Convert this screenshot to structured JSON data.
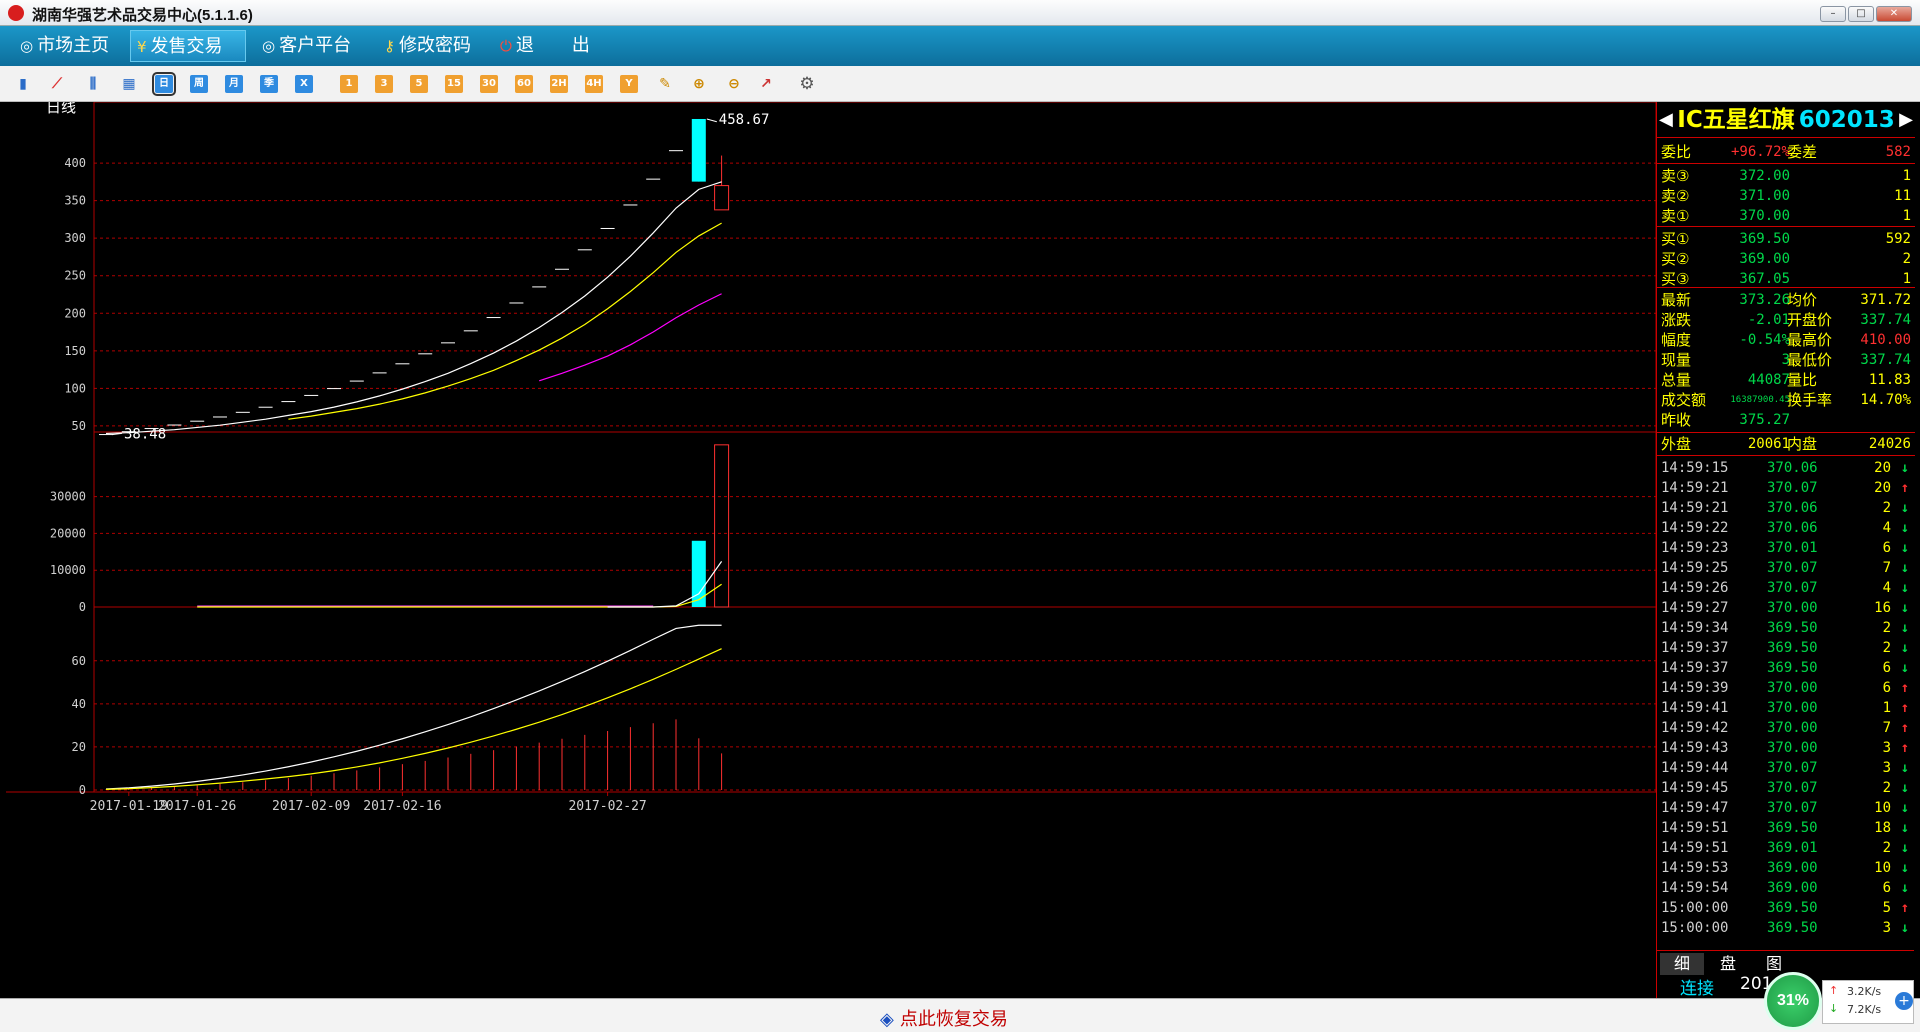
{
  "window": {
    "title": "湖南华强艺术品交易中心(5.1.1.6)"
  },
  "menu": [
    {
      "label": "市场主页",
      "icon": "swirl-icon"
    },
    {
      "label": "发售交易",
      "icon": "yen-icon"
    },
    {
      "label": "客户平台",
      "icon": "swirl-icon"
    },
    {
      "label": "修改密码",
      "icon": "key-icon"
    },
    {
      "label": "退",
      "icon": "power-icon"
    },
    {
      "label": "出",
      "icon": ""
    }
  ],
  "toolbar": {
    "period_labels": [
      "日",
      "周",
      "月",
      "季",
      "X"
    ],
    "minute_labels": [
      "1",
      "3",
      "5",
      "15",
      "30",
      "60",
      "2H",
      "4H",
      "Y"
    ]
  },
  "chart_data": [
    {
      "type": "candlestick",
      "label": "日线",
      "yticks": [
        50,
        100,
        150,
        200,
        250,
        300,
        350,
        400
      ],
      "ylim": [
        41.9,
        468
      ],
      "x_tick_labels": [
        "2017-01-19",
        "2017-01-26",
        "2017-02-09",
        "2017-02-16",
        "2017-02-27"
      ],
      "high_annotation": "458.67",
      "low_annotation": "38.48",
      "bars": [
        {
          "o": 38.5,
          "h": 38.5,
          "l": 38.5,
          "c": 38.5
        },
        {
          "o": 42.3,
          "h": 42.3,
          "l": 42.3,
          "c": 42.3
        },
        {
          "o": 46.5,
          "h": 46.5,
          "l": 46.5,
          "c": 46.5
        },
        {
          "o": 51.2,
          "h": 51.2,
          "l": 51.2,
          "c": 51.2
        },
        {
          "o": 56.3,
          "h": 56.3,
          "l": 56.3,
          "c": 56.3
        },
        {
          "o": 61.9,
          "h": 61.9,
          "l": 61.9,
          "c": 61.9
        },
        {
          "o": 68.1,
          "h": 68.1,
          "l": 68.1,
          "c": 68.1
        },
        {
          "o": 74.9,
          "h": 74.9,
          "l": 74.9,
          "c": 74.9
        },
        {
          "o": 82.4,
          "h": 82.4,
          "l": 82.4,
          "c": 82.4
        },
        {
          "o": 90.6,
          "h": 90.6,
          "l": 90.6,
          "c": 90.6
        },
        {
          "o": 99.7,
          "h": 99.7,
          "l": 99.7,
          "c": 99.7
        },
        {
          "o": 109.7,
          "h": 109.7,
          "l": 109.7,
          "c": 109.7
        },
        {
          "o": 120.6,
          "h": 120.6,
          "l": 120.6,
          "c": 120.6
        },
        {
          "o": 132.7,
          "h": 132.7,
          "l": 132.7,
          "c": 132.7
        },
        {
          "o": 146.0,
          "h": 146.0,
          "l": 146.0,
          "c": 146.0
        },
        {
          "o": 160.6,
          "h": 160.6,
          "l": 160.6,
          "c": 160.6
        },
        {
          "o": 176.6,
          "h": 176.6,
          "l": 176.6,
          "c": 176.6
        },
        {
          "o": 194.3,
          "h": 194.3,
          "l": 194.3,
          "c": 194.3
        },
        {
          "o": 213.7,
          "h": 213.7,
          "l": 213.7,
          "c": 213.7
        },
        {
          "o": 235.1,
          "h": 235.1,
          "l": 235.1,
          "c": 235.1
        },
        {
          "o": 258.6,
          "h": 258.6,
          "l": 258.6,
          "c": 258.6
        },
        {
          "o": 284.5,
          "h": 284.5,
          "l": 284.5,
          "c": 284.5
        },
        {
          "o": 312.9,
          "h": 312.9,
          "l": 312.9,
          "c": 312.9
        },
        {
          "o": 344.2,
          "h": 344.2,
          "l": 344.2,
          "c": 344.2
        },
        {
          "o": 378.6,
          "h": 378.6,
          "l": 378.6,
          "c": 378.6
        },
        {
          "o": 416.5,
          "h": 416.5,
          "l": 416.5,
          "c": 416.5
        },
        {
          "o": 375.3,
          "h": 458.7,
          "l": 375.3,
          "c": 458.7
        },
        {
          "o": 370.0,
          "h": 410.0,
          "l": 337.7,
          "c": 337.7
        }
      ],
      "ma_white": [
        40,
        41,
        43,
        45,
        48,
        51,
        55,
        59,
        64,
        69,
        75,
        82,
        90,
        99,
        109,
        120,
        133,
        147,
        163,
        181,
        201,
        223,
        248,
        276,
        307,
        340,
        365,
        375
      ],
      "ma_yellow": [
        null,
        null,
        null,
        null,
        null,
        null,
        null,
        null,
        59,
        63,
        68,
        73,
        79,
        86,
        94,
        103,
        113,
        124,
        137,
        151,
        167,
        185,
        206,
        229,
        254,
        281,
        303,
        320
      ],
      "ma_magenta": [
        null,
        null,
        null,
        null,
        null,
        null,
        null,
        null,
        null,
        null,
        null,
        null,
        null,
        null,
        null,
        null,
        null,
        null,
        null,
        110,
        120,
        131,
        143,
        158,
        175,
        194,
        211,
        226
      ]
    },
    {
      "type": "bar",
      "label": "volume",
      "yticks": [
        0,
        10000,
        20000,
        30000
      ],
      "ylim": [
        0,
        43500
      ],
      "values": [
        0,
        0,
        0,
        0,
        0,
        0,
        0,
        0,
        0,
        0,
        0,
        0,
        0,
        0,
        0,
        0,
        0,
        0,
        0,
        0,
        0,
        0,
        0,
        0,
        0,
        0,
        18000,
        44087
      ],
      "ma_white": [
        0,
        0,
        0,
        0,
        0,
        0,
        0,
        0,
        0,
        0,
        0,
        0,
        0,
        0,
        0,
        0,
        0,
        0,
        0,
        0,
        0,
        0,
        0,
        0,
        0,
        300,
        3600,
        12400
      ],
      "ma_yellow": [
        0,
        0,
        0,
        0,
        0,
        0,
        0,
        0,
        0,
        0,
        0,
        0,
        0,
        0,
        0,
        0,
        0,
        0,
        0,
        0,
        0,
        0,
        0,
        0,
        0,
        150,
        2000,
        6200
      ]
    },
    {
      "type": "indicator",
      "yticks": [
        0,
        20,
        40,
        60
      ],
      "ylim": [
        0,
        78
      ],
      "histogram": [
        0.3,
        0.6,
        1.0,
        1.5,
        2.1,
        2.8,
        3.6,
        4.5,
        5.5,
        6.6,
        7.8,
        9.1,
        10.5,
        12.0,
        13.5,
        15.1,
        16.8,
        18.5,
        20.2,
        22.0,
        23.8,
        25.6,
        27.4,
        29.2,
        31.0,
        32.8,
        24.0,
        17.0
      ],
      "line_white": [
        0.5,
        1,
        1.8,
        2.8,
        4,
        5.4,
        7,
        8.8,
        10.8,
        13,
        15.4,
        18,
        20.8,
        23.8,
        27,
        30.4,
        34,
        37.8,
        41.8,
        46,
        50.4,
        55,
        59.8,
        64.8,
        70,
        75,
        76.5,
        76.5
      ],
      "line_yellow": [
        0.3,
        0.6,
        1.1,
        1.7,
        2.4,
        3.2,
        4.1,
        5.1,
        6.2,
        7.5,
        9,
        10.7,
        12.6,
        14.7,
        17,
        19.5,
        22.2,
        25.1,
        28.2,
        31.5,
        35,
        38.8,
        42.8,
        47,
        51.4,
        56,
        60.8,
        65.6
      ]
    }
  ],
  "quote": {
    "name": "IC五星红旗",
    "code": "602013",
    "weibi_label": "委比",
    "weibi_value": "+96.72%",
    "weicha_label": "委差",
    "weicha_value": "582",
    "sells": [
      {
        "label": "卖③",
        "price": "372.00",
        "vol": "1"
      },
      {
        "label": "卖②",
        "price": "371.00",
        "vol": "11"
      },
      {
        "label": "卖①",
        "price": "370.00",
        "vol": "1"
      }
    ],
    "buys": [
      {
        "label": "买①",
        "price": "369.50",
        "vol": "592"
      },
      {
        "label": "买②",
        "price": "369.00",
        "vol": "2"
      },
      {
        "label": "买③",
        "price": "367.05",
        "vol": "1"
      }
    ],
    "stats": [
      {
        "l1": "最新",
        "v1": "373.26",
        "l2": "均价",
        "v2": "371.72"
      },
      {
        "l1": "涨跌",
        "v1": "-2.01",
        "l2": "开盘价",
        "v2": "337.74"
      },
      {
        "l1": "幅度",
        "v1": "-0.54%",
        "l2": "最高价",
        "v2": "410.00"
      },
      {
        "l1": "现量",
        "v1": "3",
        "l2": "最低价",
        "v2": "337.74"
      },
      {
        "l1": "总量",
        "v1": "44087",
        "l2": "量比",
        "v2": "11.83"
      },
      {
        "l1": "成交额",
        "v1": "16387900.45",
        "l2": "换手率",
        "v2": "14.70%"
      },
      {
        "l1": "昨收",
        "v1": "375.27",
        "l2": "",
        "v2": ""
      }
    ],
    "waipan_label": "外盘",
    "waipan": "20061",
    "neipan_label": "内盘",
    "neipan": "24026"
  },
  "ticks": [
    {
      "time": "14:59:15",
      "price": "370.06",
      "vol": "20",
      "dir": "down"
    },
    {
      "time": "14:59:21",
      "price": "370.07",
      "vol": "20",
      "dir": "up"
    },
    {
      "time": "14:59:21",
      "price": "370.06",
      "vol": "2",
      "dir": "down"
    },
    {
      "time": "14:59:22",
      "price": "370.06",
      "vol": "4",
      "dir": "down"
    },
    {
      "time": "14:59:23",
      "price": "370.01",
      "vol": "6",
      "dir": "down"
    },
    {
      "time": "14:59:25",
      "price": "370.07",
      "vol": "7",
      "dir": "down"
    },
    {
      "time": "14:59:26",
      "price": "370.07",
      "vol": "4",
      "dir": "down"
    },
    {
      "time": "14:59:27",
      "price": "370.00",
      "vol": "16",
      "dir": "down"
    },
    {
      "time": "14:59:34",
      "price": "369.50",
      "vol": "2",
      "dir": "down"
    },
    {
      "time": "14:59:37",
      "price": "369.50",
      "vol": "2",
      "dir": "down"
    },
    {
      "time": "14:59:37",
      "price": "369.50",
      "vol": "6",
      "dir": "down"
    },
    {
      "time": "14:59:39",
      "price": "370.00",
      "vol": "6",
      "dir": "up"
    },
    {
      "time": "14:59:41",
      "price": "370.00",
      "vol": "1",
      "dir": "up"
    },
    {
      "time": "14:59:42",
      "price": "370.00",
      "vol": "7",
      "dir": "up"
    },
    {
      "time": "14:59:43",
      "price": "370.00",
      "vol": "3",
      "dir": "up"
    },
    {
      "time": "14:59:44",
      "price": "370.07",
      "vol": "3",
      "dir": "down"
    },
    {
      "time": "14:59:45",
      "price": "370.07",
      "vol": "2",
      "dir": "down"
    },
    {
      "time": "14:59:47",
      "price": "370.07",
      "vol": "10",
      "dir": "down"
    },
    {
      "time": "14:59:51",
      "price": "369.50",
      "vol": "18",
      "dir": "down"
    },
    {
      "time": "14:59:51",
      "price": "369.01",
      "vol": "2",
      "dir": "down"
    },
    {
      "time": "14:59:53",
      "price": "369.00",
      "vol": "10",
      "dir": "down"
    },
    {
      "time": "14:59:54",
      "price": "369.00",
      "vol": "6",
      "dir": "down"
    },
    {
      "time": "15:00:00",
      "price": "369.50",
      "vol": "5",
      "dir": "up"
    },
    {
      "time": "15:00:00",
      "price": "369.50",
      "vol": "3",
      "dir": "down"
    }
  ],
  "quote_tabs": [
    "细",
    "盘",
    "图"
  ],
  "status": {
    "restore": "点此恢复交易",
    "connection": "连接",
    "year_partial": "201",
    "net_percent": "31%",
    "upload": "3.2K/s",
    "download": "7.2K/s"
  },
  "colors": {
    "up_red": "#ff3030",
    "down_cyan": "#00ffff",
    "grid": "#b00000",
    "ma_white": "#ffffff",
    "ma_yellow": "#ffff00",
    "ma_magenta": "#ff00ff"
  }
}
